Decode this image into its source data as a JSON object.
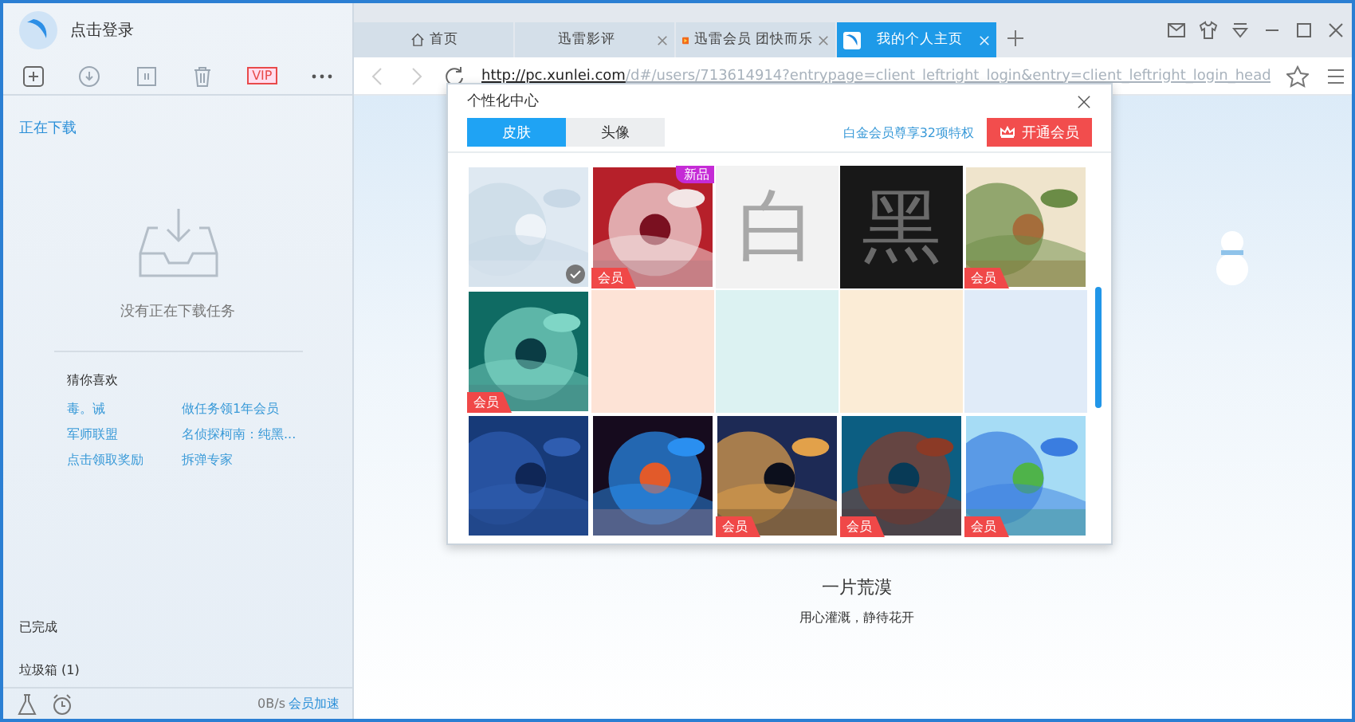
{
  "sidebar": {
    "login": "点击登录",
    "toolbar": [
      {
        "kind": "add"
      },
      {
        "kind": "download"
      },
      {
        "kind": "pause"
      },
      {
        "kind": "delete"
      },
      {
        "kind": "vip",
        "label": "VIP"
      },
      {
        "kind": "more"
      }
    ],
    "section": "正在下载",
    "empty_text": "没有正在下载任务",
    "recommend_title": "猜你喜欢",
    "recommend_links": [
      "毒。诫",
      "做任务领1年会员",
      "军师联盟",
      "名侦探柯南：纯黑...",
      "点击领取奖励",
      "拆弹专家"
    ],
    "categories": [
      "已完成",
      "垃圾箱 (1)"
    ],
    "speed": "0B/s",
    "boost": "会员加速"
  },
  "tabs": [
    {
      "label": "首页",
      "kind": "home",
      "selected": false,
      "closable": false
    },
    {
      "label": "迅雷影评",
      "kind": "plain",
      "selected": false,
      "closable": true
    },
    {
      "label": "迅雷会员 团快而乐",
      "kind": "logo",
      "selected": false,
      "closable": true
    },
    {
      "label": "我的个人主页",
      "kind": "bird",
      "selected": true,
      "closable": true
    }
  ],
  "address": {
    "host": "http://pc.xunlei.com",
    "path": "/d#/users/713614914?entrypage=client_leftright_login&entry=client_leftright_login_head"
  },
  "page": {
    "title": "一片荒漠",
    "subtitle": "用心灌溉，静待花开"
  },
  "dialog": {
    "title": "个性化中心",
    "tabs": [
      {
        "label": "皮肤",
        "selected": true
      },
      {
        "label": "头像",
        "selected": false
      }
    ],
    "perk_link": "白金会员尊享32项特权",
    "join_button": "开通会员",
    "skins": [
      {
        "kind": "picture",
        "selected": true
      },
      {
        "kind": "picture",
        "badge": "会员",
        "tag": "新品",
        "selected": false
      },
      {
        "kind": "plain",
        "label": "白",
        "color": "#f2f2f2",
        "selected": false
      },
      {
        "kind": "plain",
        "label": "黑",
        "color": "#181818",
        "selected": false
      },
      {
        "kind": "picture",
        "badge": "会员",
        "selected": false
      },
      {
        "kind": "picture",
        "badge": "会员",
        "selected": false
      },
      {
        "kind": "plain",
        "color": "#fde3d6",
        "selected": false
      },
      {
        "kind": "plain",
        "color": "#dcf2f2",
        "selected": false
      },
      {
        "kind": "plain",
        "color": "#fbecd6",
        "selected": false
      },
      {
        "kind": "plain",
        "color": "#e0ebf8",
        "selected": false
      },
      {
        "kind": "picture",
        "selected": false
      },
      {
        "kind": "picture",
        "selected": false
      },
      {
        "kind": "picture",
        "badge": "会员",
        "selected": false
      },
      {
        "kind": "picture",
        "badge": "会员",
        "selected": false
      },
      {
        "kind": "picture",
        "badge": "会员",
        "selected": false
      }
    ]
  }
}
